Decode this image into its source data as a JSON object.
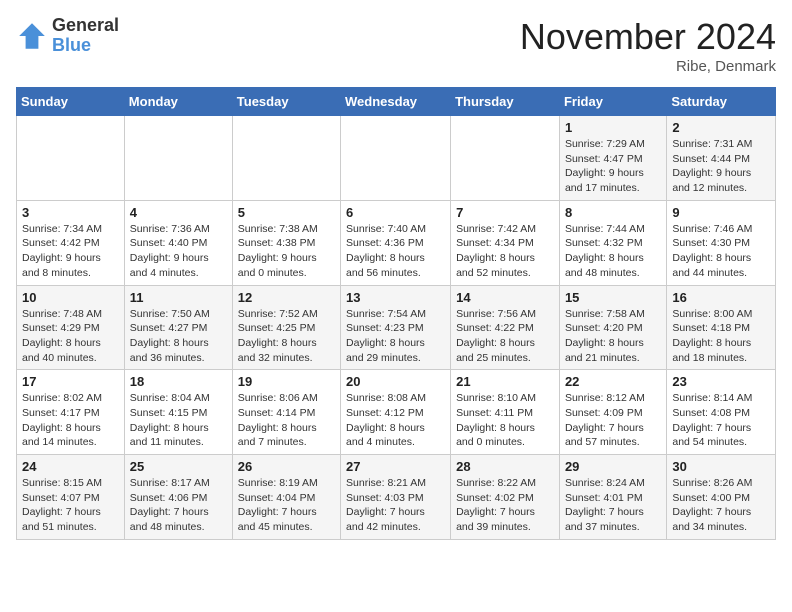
{
  "logo": {
    "general": "General",
    "blue": "Blue"
  },
  "title": "November 2024",
  "location": "Ribe, Denmark",
  "days_of_week": [
    "Sunday",
    "Monday",
    "Tuesday",
    "Wednesday",
    "Thursday",
    "Friday",
    "Saturday"
  ],
  "weeks": [
    [
      {
        "day": "",
        "info": ""
      },
      {
        "day": "",
        "info": ""
      },
      {
        "day": "",
        "info": ""
      },
      {
        "day": "",
        "info": ""
      },
      {
        "day": "",
        "info": ""
      },
      {
        "day": "1",
        "info": "Sunrise: 7:29 AM\nSunset: 4:47 PM\nDaylight: 9 hours\nand 17 minutes."
      },
      {
        "day": "2",
        "info": "Sunrise: 7:31 AM\nSunset: 4:44 PM\nDaylight: 9 hours\nand 12 minutes."
      }
    ],
    [
      {
        "day": "3",
        "info": "Sunrise: 7:34 AM\nSunset: 4:42 PM\nDaylight: 9 hours\nand 8 minutes."
      },
      {
        "day": "4",
        "info": "Sunrise: 7:36 AM\nSunset: 4:40 PM\nDaylight: 9 hours\nand 4 minutes."
      },
      {
        "day": "5",
        "info": "Sunrise: 7:38 AM\nSunset: 4:38 PM\nDaylight: 9 hours\nand 0 minutes."
      },
      {
        "day": "6",
        "info": "Sunrise: 7:40 AM\nSunset: 4:36 PM\nDaylight: 8 hours\nand 56 minutes."
      },
      {
        "day": "7",
        "info": "Sunrise: 7:42 AM\nSunset: 4:34 PM\nDaylight: 8 hours\nand 52 minutes."
      },
      {
        "day": "8",
        "info": "Sunrise: 7:44 AM\nSunset: 4:32 PM\nDaylight: 8 hours\nand 48 minutes."
      },
      {
        "day": "9",
        "info": "Sunrise: 7:46 AM\nSunset: 4:30 PM\nDaylight: 8 hours\nand 44 minutes."
      }
    ],
    [
      {
        "day": "10",
        "info": "Sunrise: 7:48 AM\nSunset: 4:29 PM\nDaylight: 8 hours\nand 40 minutes."
      },
      {
        "day": "11",
        "info": "Sunrise: 7:50 AM\nSunset: 4:27 PM\nDaylight: 8 hours\nand 36 minutes."
      },
      {
        "day": "12",
        "info": "Sunrise: 7:52 AM\nSunset: 4:25 PM\nDaylight: 8 hours\nand 32 minutes."
      },
      {
        "day": "13",
        "info": "Sunrise: 7:54 AM\nSunset: 4:23 PM\nDaylight: 8 hours\nand 29 minutes."
      },
      {
        "day": "14",
        "info": "Sunrise: 7:56 AM\nSunset: 4:22 PM\nDaylight: 8 hours\nand 25 minutes."
      },
      {
        "day": "15",
        "info": "Sunrise: 7:58 AM\nSunset: 4:20 PM\nDaylight: 8 hours\nand 21 minutes."
      },
      {
        "day": "16",
        "info": "Sunrise: 8:00 AM\nSunset: 4:18 PM\nDaylight: 8 hours\nand 18 minutes."
      }
    ],
    [
      {
        "day": "17",
        "info": "Sunrise: 8:02 AM\nSunset: 4:17 PM\nDaylight: 8 hours\nand 14 minutes."
      },
      {
        "day": "18",
        "info": "Sunrise: 8:04 AM\nSunset: 4:15 PM\nDaylight: 8 hours\nand 11 minutes."
      },
      {
        "day": "19",
        "info": "Sunrise: 8:06 AM\nSunset: 4:14 PM\nDaylight: 8 hours\nand 7 minutes."
      },
      {
        "day": "20",
        "info": "Sunrise: 8:08 AM\nSunset: 4:12 PM\nDaylight: 8 hours\nand 4 minutes."
      },
      {
        "day": "21",
        "info": "Sunrise: 8:10 AM\nSunset: 4:11 PM\nDaylight: 8 hours\nand 0 minutes."
      },
      {
        "day": "22",
        "info": "Sunrise: 8:12 AM\nSunset: 4:09 PM\nDaylight: 7 hours\nand 57 minutes."
      },
      {
        "day": "23",
        "info": "Sunrise: 8:14 AM\nSunset: 4:08 PM\nDaylight: 7 hours\nand 54 minutes."
      }
    ],
    [
      {
        "day": "24",
        "info": "Sunrise: 8:15 AM\nSunset: 4:07 PM\nDaylight: 7 hours\nand 51 minutes."
      },
      {
        "day": "25",
        "info": "Sunrise: 8:17 AM\nSunset: 4:06 PM\nDaylight: 7 hours\nand 48 minutes."
      },
      {
        "day": "26",
        "info": "Sunrise: 8:19 AM\nSunset: 4:04 PM\nDaylight: 7 hours\nand 45 minutes."
      },
      {
        "day": "27",
        "info": "Sunrise: 8:21 AM\nSunset: 4:03 PM\nDaylight: 7 hours\nand 42 minutes."
      },
      {
        "day": "28",
        "info": "Sunrise: 8:22 AM\nSunset: 4:02 PM\nDaylight: 7 hours\nand 39 minutes."
      },
      {
        "day": "29",
        "info": "Sunrise: 8:24 AM\nSunset: 4:01 PM\nDaylight: 7 hours\nand 37 minutes."
      },
      {
        "day": "30",
        "info": "Sunrise: 8:26 AM\nSunset: 4:00 PM\nDaylight: 7 hours\nand 34 minutes."
      }
    ]
  ]
}
